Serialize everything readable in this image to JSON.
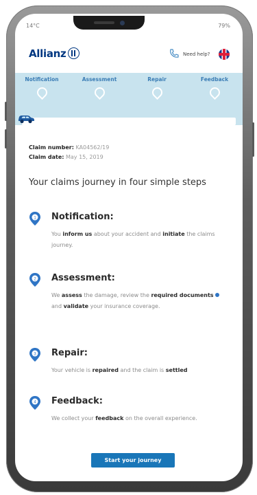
{
  "status_bar": {
    "left": "14°C",
    "right": "79%"
  },
  "header": {
    "brand": "Allianz",
    "help_label": "Need help?"
  },
  "steps": [
    {
      "label": "Notification"
    },
    {
      "label": "Assessment"
    },
    {
      "label": "Repair"
    },
    {
      "label": "Feedback"
    }
  ],
  "progress": {
    "value": 0
  },
  "claim": {
    "number_label": "Claim number:",
    "number_value": "KA04562/19",
    "date_label": "Claim date:",
    "date_value": "May 15, 2019"
  },
  "intro": "Your claims journey in four simple steps",
  "items": [
    {
      "title": "Notification:",
      "text": {
        "a": "You ",
        "b": "inform us",
        "c": " about your accident and ",
        "d": "initiate",
        "e": " the claims journey."
      }
    },
    {
      "title": "Assessment:",
      "text": {
        "a": "We ",
        "b": "assess",
        "c": " the damage, review the ",
        "d": "required documents",
        "e": " and ",
        "f": "validate",
        "g": " your insurance coverage."
      }
    },
    {
      "title": "Repair:",
      "text": {
        "a": "Your vehicle is ",
        "b": "repaired",
        "c": " and the claim is ",
        "d": "settled"
      }
    },
    {
      "title": "Feedback:",
      "text": {
        "a": "We collect your ",
        "b": "feedback",
        "c": " on the overall experience."
      }
    }
  ],
  "cta_label": "Start your journey",
  "colors": {
    "brand": "#003781",
    "accent": "#1976b8",
    "steps_bg": "#c8e3ee"
  }
}
